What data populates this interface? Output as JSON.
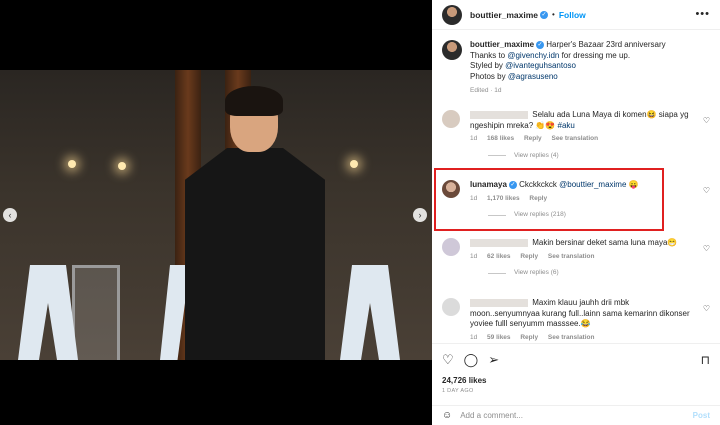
{
  "post": {
    "username": "bouttier_maxime",
    "follow_label": "Follow",
    "more_label": "•••",
    "caption": {
      "text": "Harper's Bazaar 23rd anniversary",
      "line2_prefix": "Thanks to ",
      "line2_mention": "@givenchy.idn",
      "line2_suffix": " for dressing me up.",
      "line3_prefix": "Styled by ",
      "line3_mention": "@ivanteguhsantoso",
      "line4_prefix": "Photos by ",
      "line4_mention": "@agrasuseno",
      "meta": "Edited · 1d"
    },
    "likes": "24,726 likes",
    "time_ago": "1 DAY AGO"
  },
  "comments": [
    {
      "text": "Selalu ada Luna Maya di komen😆 siapa yg ngeshipin mreka? 👏😍",
      "hashtag": "#aku",
      "time": "1d",
      "likes": "168 likes",
      "reply_label": "Reply",
      "translate_label": "See translation",
      "replies": "View replies (4)"
    },
    {
      "username": "lunamaya",
      "mention": "@bouttier_maxime",
      "text": "Ckckkckck",
      "emoji": "😛",
      "time": "1d",
      "likes": "1,170 likes",
      "reply_label": "Reply",
      "replies": "View replies (218)"
    },
    {
      "text": "Makin bersinar deket sama luna maya😁",
      "time": "1d",
      "likes": "62 likes",
      "reply_label": "Reply",
      "translate_label": "See translation",
      "replies": "View replies (6)"
    },
    {
      "text": "Maxim klauu jauhh drii mbk moon..senyumnyaa kurang full..lainn sama kemarinn dikonser yoviee fulll senyumm masssee.😂",
      "time": "1d",
      "likes": "59 likes",
      "reply_label": "Reply",
      "translate_label": "See translation"
    }
  ],
  "add_comment": {
    "placeholder": "Add a comment...",
    "post_label": "Post"
  },
  "nav": {
    "prev": "‹",
    "next": "›"
  },
  "icons": [
    "heart-icon",
    "comment-icon",
    "share-icon",
    "bookmark-icon",
    "emoji-icon",
    "verified-icon"
  ],
  "colors": {
    "accent": "#0095f6",
    "highlight": "#e02020",
    "mention": "#00376b"
  }
}
